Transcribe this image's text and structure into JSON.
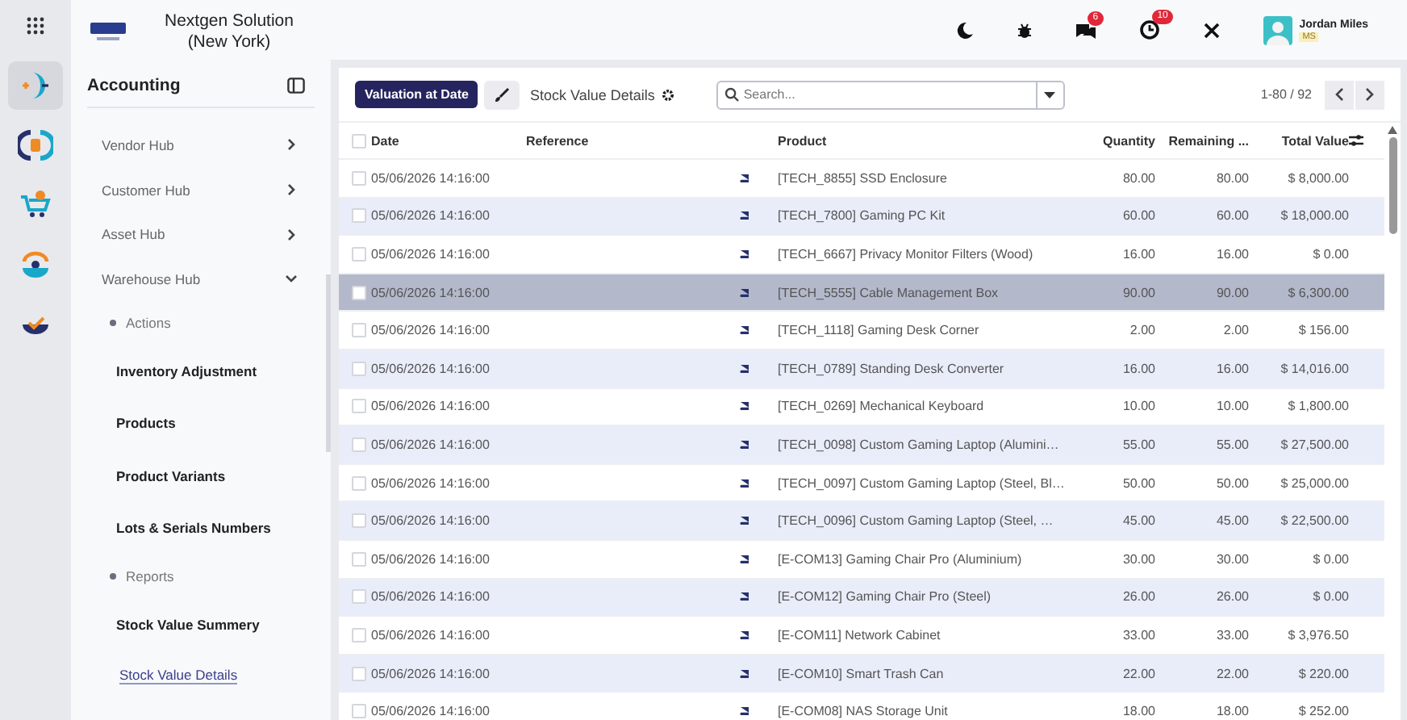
{
  "company": {
    "name": "Nextgen Solution (New York)"
  },
  "rail": [
    {
      "selected": true
    },
    {
      "selected": false
    },
    {
      "selected": false
    },
    {
      "selected": false
    },
    {
      "selected": false
    }
  ],
  "topbar": {
    "chat_badge": "6",
    "activity_badge": "10",
    "user": {
      "name": "Jordan Miles",
      "tag": "MS"
    }
  },
  "sidebar": {
    "title": "Accounting",
    "items": [
      {
        "kind": "group",
        "label": "Vendor Hub",
        "expanded": false
      },
      {
        "kind": "group",
        "label": "Customer Hub",
        "expanded": false
      },
      {
        "kind": "group",
        "label": "Asset Hub",
        "expanded": false
      },
      {
        "kind": "group",
        "label": "Warehouse Hub",
        "expanded": true
      },
      {
        "kind": "section",
        "label": "Actions"
      },
      {
        "kind": "link",
        "label": "Inventory Adjustment",
        "selected": false
      },
      {
        "kind": "link",
        "label": "Products",
        "selected": false
      },
      {
        "kind": "link",
        "label": "Product Variants",
        "selected": false
      },
      {
        "kind": "link",
        "label": "Lots & Serials Numbers",
        "selected": false
      },
      {
        "kind": "section",
        "label": "Reports"
      },
      {
        "kind": "link",
        "label": "Stock Value Summery",
        "selected": false
      },
      {
        "kind": "link",
        "label": "Stock Value Details",
        "selected": true
      }
    ]
  },
  "toolbar": {
    "primary_button": "Valuation at Date",
    "view_title": "Stock Value Details",
    "search": {
      "placeholder": "Search..."
    },
    "pager": "1-80 / 92"
  },
  "table": {
    "all_checked": false,
    "columns": [
      "Date",
      "Reference",
      "Product",
      "Quantity",
      "Remaining ...",
      "Total Value"
    ],
    "rows": [
      {
        "date": "05/06/2026 14:16:00",
        "product": "[TECH_8855] SSD Enclosure",
        "quantity": "80.00",
        "remaining": "80.00",
        "total": "$ 8,000.00",
        "selected": false,
        "checked": false
      },
      {
        "date": "05/06/2026 14:16:00",
        "product": "[TECH_7800] Gaming PC Kit",
        "quantity": "60.00",
        "remaining": "60.00",
        "total": "$ 18,000.00",
        "selected": false,
        "checked": false
      },
      {
        "date": "05/06/2026 14:16:00",
        "product": "[TECH_6667] Privacy Monitor Filters (Wood)",
        "quantity": "16.00",
        "remaining": "16.00",
        "total": "$ 0.00",
        "selected": false,
        "checked": false
      },
      {
        "date": "05/06/2026 14:16:00",
        "product": "[TECH_5555] Cable Management Box",
        "quantity": "90.00",
        "remaining": "90.00",
        "total": "$ 6,300.00",
        "selected": true,
        "checked": false
      },
      {
        "date": "05/06/2026 14:16:00",
        "product": "[TECH_1118] Gaming Desk Corner",
        "quantity": "2.00",
        "remaining": "2.00",
        "total": "$ 156.00",
        "selected": false,
        "checked": false
      },
      {
        "date": "05/06/2026 14:16:00",
        "product": "[TECH_0789] Standing Desk Converter",
        "quantity": "16.00",
        "remaining": "16.00",
        "total": "$ 14,016.00",
        "selected": false,
        "checked": false
      },
      {
        "date": "05/06/2026 14:16:00",
        "product": "[TECH_0269] Mechanical Keyboard",
        "quantity": "10.00",
        "remaining": "10.00",
        "total": "$ 1,800.00",
        "selected": false,
        "checked": false
      },
      {
        "date": "05/06/2026 14:16:00",
        "product": "[TECH_0098] Custom Gaming Laptop (Alumini…",
        "quantity": "55.00",
        "remaining": "55.00",
        "total": "$ 27,500.00",
        "selected": false,
        "checked": false
      },
      {
        "date": "05/06/2026 14:16:00",
        "product": "[TECH_0097] Custom Gaming Laptop (Steel, Bl…",
        "quantity": "50.00",
        "remaining": "50.00",
        "total": "$ 25,000.00",
        "selected": false,
        "checked": false
      },
      {
        "date": "05/06/2026 14:16:00",
        "product": "[TECH_0096] Custom Gaming Laptop (Steel, …",
        "quantity": "45.00",
        "remaining": "45.00",
        "total": "$ 22,500.00",
        "selected": false,
        "checked": false
      },
      {
        "date": "05/06/2026 14:16:00",
        "product": "[E-COM13] Gaming Chair Pro (Aluminium)",
        "quantity": "30.00",
        "remaining": "30.00",
        "total": "$ 0.00",
        "selected": false,
        "checked": false
      },
      {
        "date": "05/06/2026 14:16:00",
        "product": "[E-COM12] Gaming Chair Pro (Steel)",
        "quantity": "26.00",
        "remaining": "26.00",
        "total": "$ 0.00",
        "selected": false,
        "checked": false
      },
      {
        "date": "05/06/2026 14:16:00",
        "product": "[E-COM11] Network Cabinet",
        "quantity": "33.00",
        "remaining": "33.00",
        "total": "$ 3,976.50",
        "selected": false,
        "checked": false
      },
      {
        "date": "05/06/2026 14:16:00",
        "product": "[E-COM10] Smart Trash Can",
        "quantity": "22.00",
        "remaining": "22.00",
        "total": "$ 220.00",
        "selected": false,
        "checked": false
      },
      {
        "date": "05/06/2026 14:16:00",
        "product": "[E-COM08] NAS Storage Unit",
        "quantity": "18.00",
        "remaining": "18.00",
        "total": "$ 252.00",
        "selected": false,
        "checked": false
      }
    ]
  }
}
